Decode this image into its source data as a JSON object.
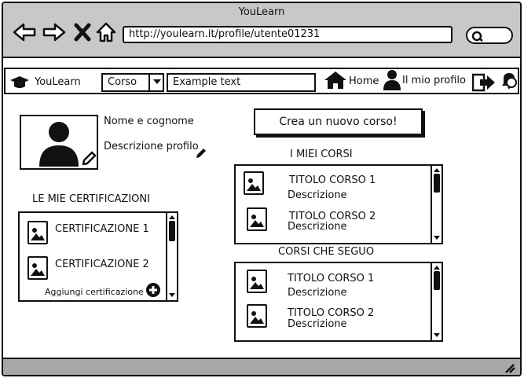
{
  "window": {
    "title": "YouLearn"
  },
  "browser": {
    "url": "http://youlearn.it/profile/utente01231",
    "nav": [
      "back-icon",
      "forward-icon",
      "close-icon",
      "home-icon"
    ],
    "search_icon": "search-icon"
  },
  "appbar": {
    "brand": "YouLearn",
    "brand_icon": "graduation-cap-icon",
    "select_value": "Corso",
    "search_text": "Example text",
    "home_label": "Home",
    "profile_label": "Il mio profilo",
    "logout_icon": "logout-icon",
    "notifications_icon": "notification-bell-icon"
  },
  "profile": {
    "name_label": "Nome e cognome",
    "description_label": "Descrizione profilo"
  },
  "certifications": {
    "heading": "LE MIE CERTIFICAZIONI",
    "items": [
      {
        "label": "CERTIFICAZIONE 1"
      },
      {
        "label": "CERTIFICAZIONE 2"
      }
    ],
    "add_label": "Aggiungi certificazione"
  },
  "create_button": "Crea un nuovo corso!",
  "my_courses": {
    "heading": "I MIEI CORSI",
    "items": [
      {
        "title": "TITOLO CORSO 1",
        "desc": "Descrizione"
      },
      {
        "title": "TITOLO CORSO 2",
        "desc": "Descrizione"
      }
    ]
  },
  "followed_courses": {
    "heading": "CORSI CHE SEGUO",
    "items": [
      {
        "title": "TITOLO CORSO 1",
        "desc": "Descrizione"
      },
      {
        "title": "TITOLO CORSO 2",
        "desc": "Descrizione"
      }
    ]
  }
}
